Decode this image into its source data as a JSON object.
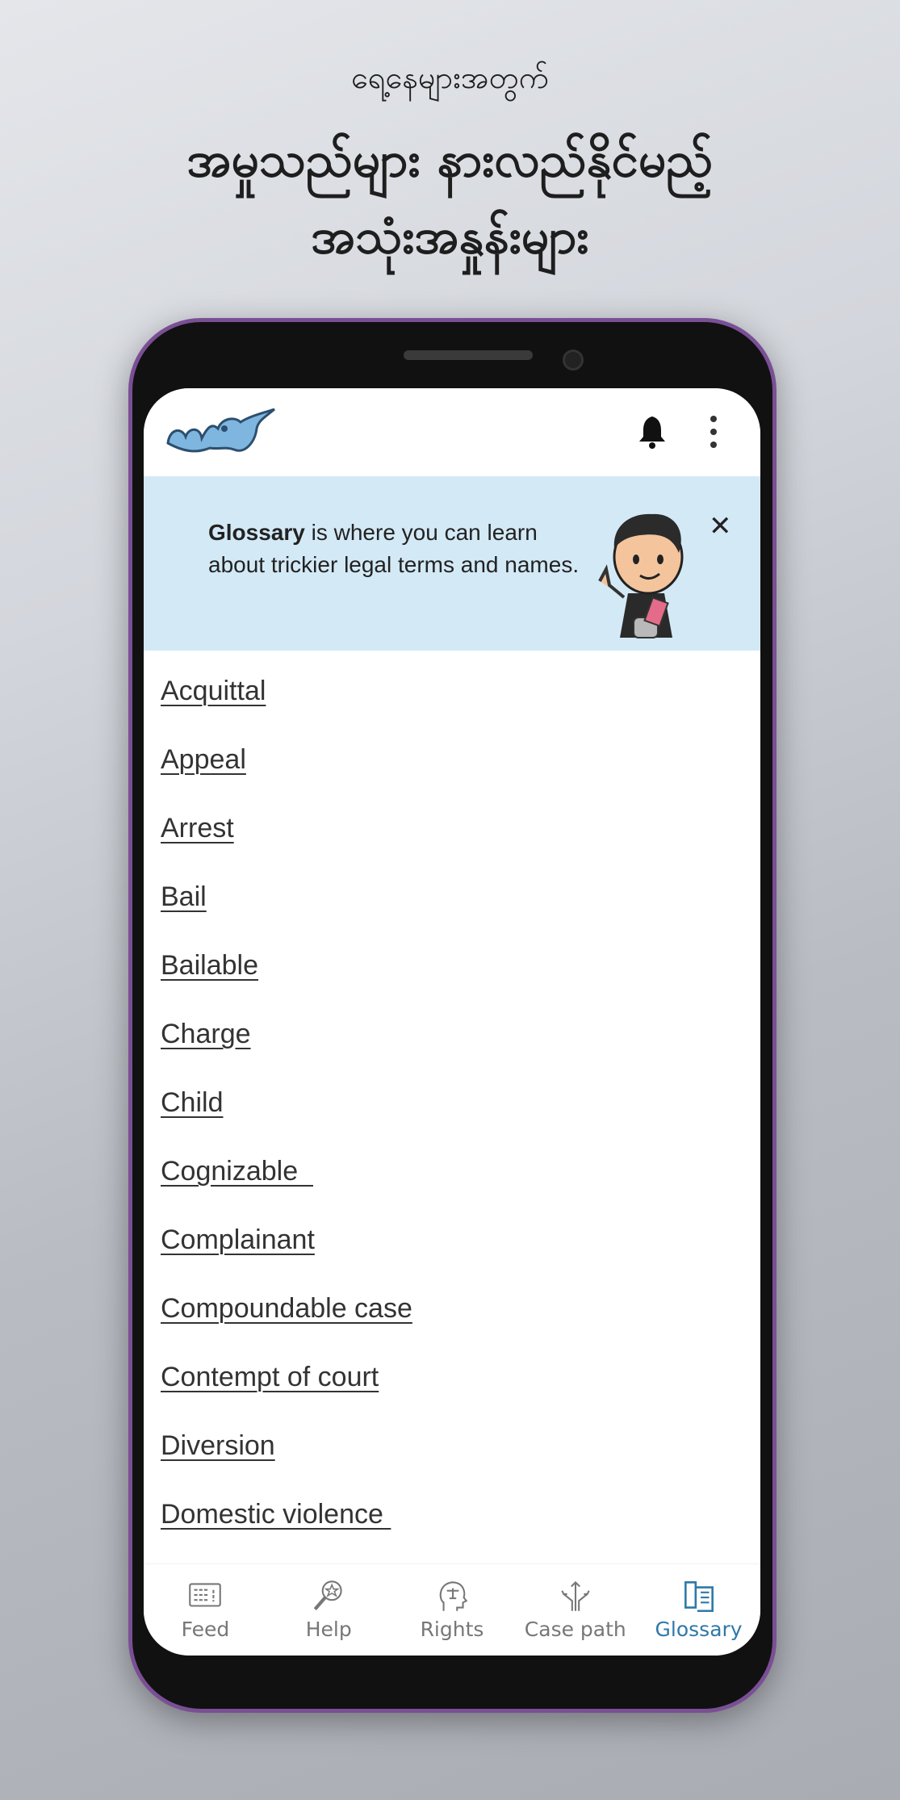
{
  "headline": {
    "line1": "ရေ့နေများအတွက်",
    "line2": "အမှုသည်များ နားလည်နိုင်မည့်",
    "line3": "အသုံးအနှုန်းများ"
  },
  "app": {
    "logo_text": "ယဉ်မြ",
    "banner": {
      "bold": "Glossary",
      "text": " is where you can learn about trickier legal terms and names."
    }
  },
  "glossary": [
    "Acquittal",
    "Appeal",
    "Arrest",
    "Bail",
    "Bailable",
    "Charge",
    "Child",
    "Cognizable  ",
    "Complainant",
    "Compoundable case",
    "Contempt of court",
    "Diversion",
    "Domestic violence "
  ],
  "nav": [
    {
      "label": "Feed",
      "icon": "feed-icon"
    },
    {
      "label": "Help",
      "icon": "magnifier-star-icon"
    },
    {
      "label": "Rights",
      "icon": "head-scales-icon"
    },
    {
      "label": "Case path",
      "icon": "split-arrows-icon"
    },
    {
      "label": "Glossary",
      "icon": "book-icon",
      "active": true
    }
  ],
  "colors": {
    "accent": "#2f78a8",
    "banner": "#d3e9f6",
    "frame": "#7a4f95"
  }
}
